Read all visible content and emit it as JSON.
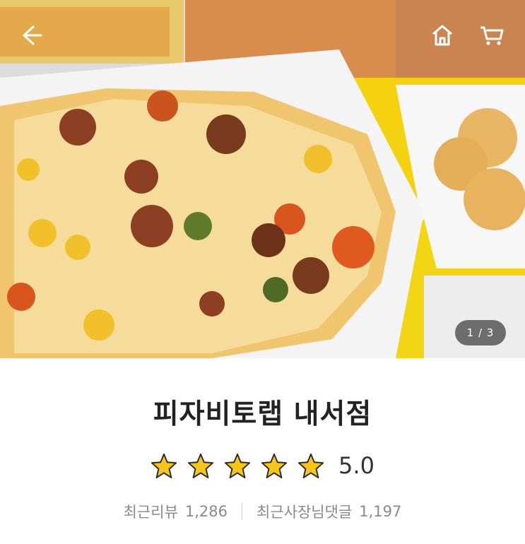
{
  "hero": {
    "page_indicator": "1 / 3",
    "icons": [
      "back-arrow-icon",
      "home-icon",
      "cart-icon"
    ]
  },
  "store": {
    "name": "피자비토랩 내서점",
    "rating": 5.0,
    "rating_text": "5.0",
    "star_count": 5,
    "star_color": "#f5c518"
  },
  "stats": {
    "recent_reviews_label": "최근리뷰",
    "recent_reviews_count": "1,286",
    "owner_replies_label": "최근사장님댓글",
    "owner_replies_count": "1,197"
  }
}
